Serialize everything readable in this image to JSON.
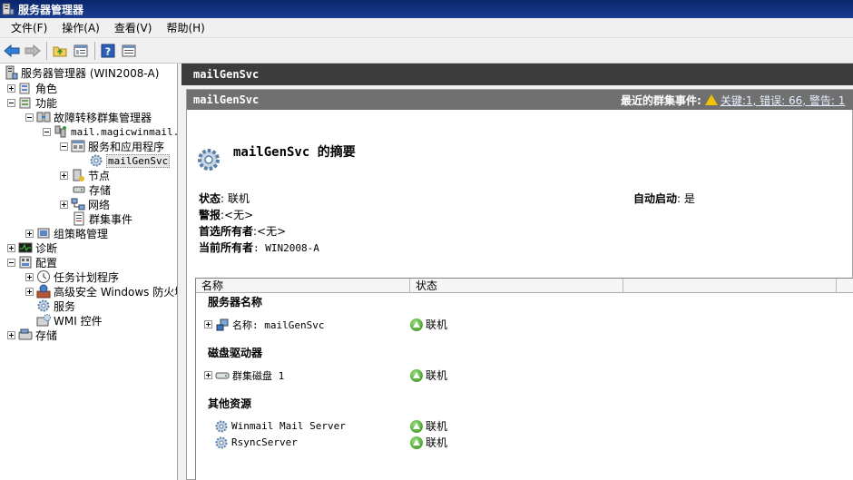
{
  "window": {
    "title": "服务器管理器"
  },
  "menu": [
    "文件(F)",
    "操作(A)",
    "查看(V)",
    "帮助(H)"
  ],
  "toolbar": {
    "icons": [
      "back-icon",
      "forward-icon",
      "up-folder-icon",
      "show-hide-tree-icon",
      "help-icon",
      "properties-icon"
    ]
  },
  "tree": {
    "root": "服务器管理器 (WIN2008-A)",
    "items": [
      {
        "label": "角色"
      },
      {
        "label": "功能"
      },
      {
        "label": "故障转移群集管理器"
      },
      {
        "label": "mail.magicwinmail.c"
      },
      {
        "label": "服务和应用程序"
      },
      {
        "label": "mailGenSvc"
      },
      {
        "label": "节点"
      },
      {
        "label": "存储"
      },
      {
        "label": "网络"
      },
      {
        "label": "群集事件"
      },
      {
        "label": "组策略管理"
      },
      {
        "label": "诊断"
      },
      {
        "label": "配置"
      },
      {
        "label": "任务计划程序"
      },
      {
        "label": "高级安全 Windows 防火墙"
      },
      {
        "label": "服务"
      },
      {
        "label": "WMI 控件"
      },
      {
        "label": "存储"
      }
    ]
  },
  "right": {
    "header_title": "mailGenSvc",
    "panel_title": "mailGenSvc",
    "events_label": "最近的群集事件:",
    "events_link": "关键:1, 错误: 66, 警告: 1",
    "summary_title": "mailGenSvc 的摘要",
    "props": {
      "status_key": "状态",
      "status_val": ": 联机",
      "alert_key": "警报",
      "alert_val": ":<无>",
      "preferred_key": "首选所有者",
      "preferred_val": ":<无>",
      "current_key": "当前所有者",
      "current_val": ": WIN2008-A",
      "autostart_key": "自动启动",
      "autostart_val": ": 是"
    },
    "columns": [
      "名称",
      "状态"
    ],
    "groups": {
      "server_name": "服务器名称",
      "disks": "磁盘驱动器",
      "other": "其他资源"
    },
    "resources": {
      "server_name_row": {
        "name": "名称: mailGenSvc",
        "status": "联机"
      },
      "disk_row": {
        "name": "群集磁盘 1",
        "status": "联机"
      },
      "other_rows": [
        {
          "name": "Winmail Mail Server",
          "status": "联机"
        },
        {
          "name": "RsyncServer",
          "status": "联机"
        }
      ]
    }
  }
}
